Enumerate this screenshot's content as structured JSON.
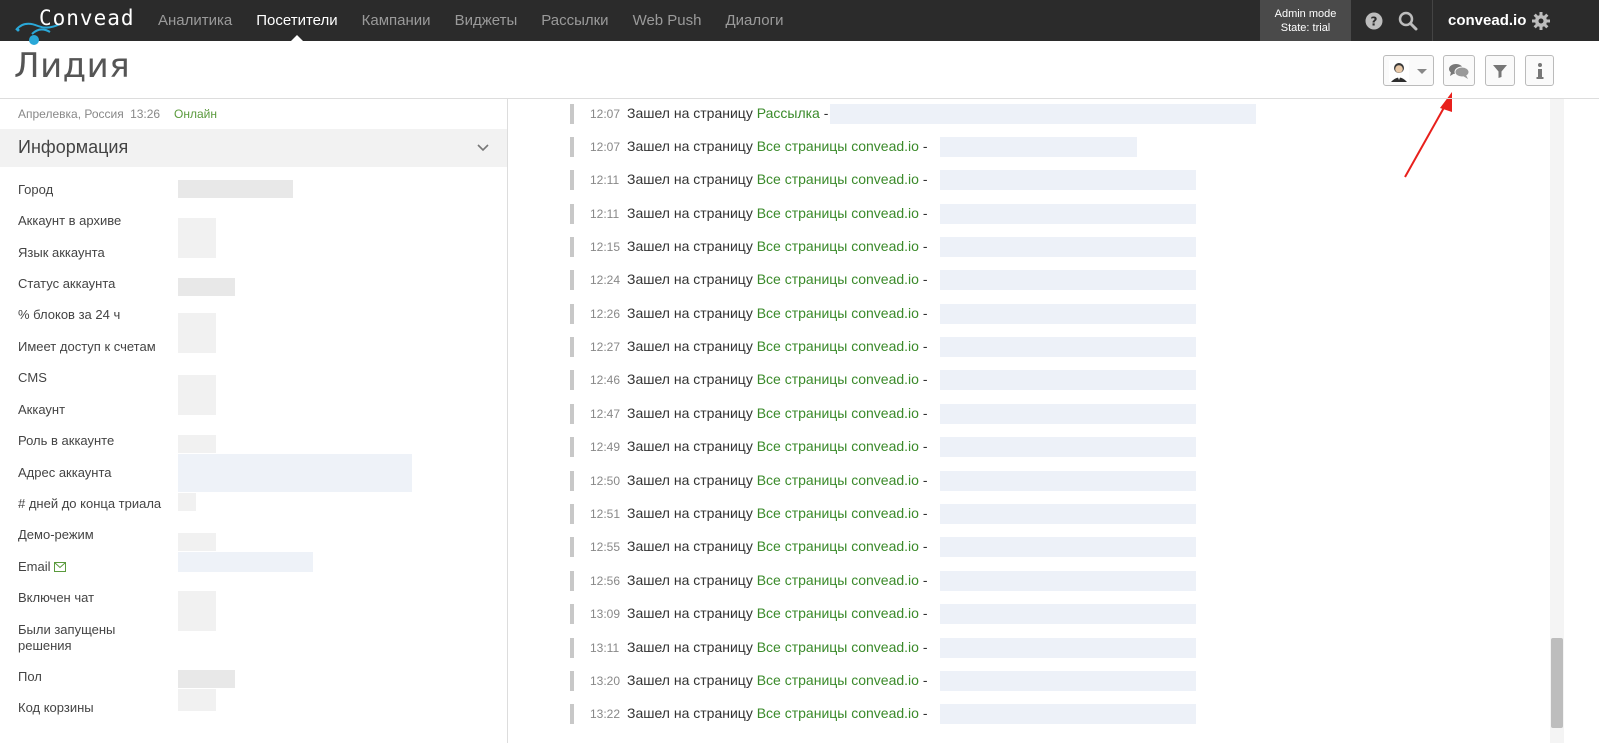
{
  "topbar": {
    "logo_text": "Convead",
    "nav": [
      {
        "label": "Аналитика",
        "active": false
      },
      {
        "label": "Посетители",
        "active": true
      },
      {
        "label": "Кампании",
        "active": false
      },
      {
        "label": "Виджеты",
        "active": false
      },
      {
        "label": "Рассылки",
        "active": false
      },
      {
        "label": "Web Push",
        "active": false
      },
      {
        "label": "Диалоги",
        "active": false
      }
    ],
    "admin_mode": "Admin mode",
    "admin_state": "State: trial",
    "account": "convead.io"
  },
  "visitor": {
    "name": "Лидия",
    "location": "Апрелевка, Россия",
    "time": "13:26",
    "status": "Онлайн"
  },
  "info_section": {
    "title": "Информация",
    "fields": [
      "Город",
      "Аккаунт в архиве",
      "Язык аккаунта",
      "Статус аккаунта",
      "% блоков за 24 ч",
      "Имеет доступ к счетам",
      "CMS",
      "Аккаунт",
      "Роль в аккаунте",
      "Адрес аккаунта",
      "# дней до конца триала",
      "Демо-режим",
      "Email",
      "Включен чат",
      "Были запущены решения",
      "Пол",
      "Код корзины"
    ]
  },
  "feed": {
    "action": "Зашел на страницу",
    "items": [
      {
        "time": "12:07",
        "page": "Рассылка",
        "sep": "-"
      },
      {
        "time": "12:07",
        "page": "Все страницы convead.io",
        "sep": "-"
      },
      {
        "time": "12:11",
        "page": "Все страницы convead.io",
        "sep": "-"
      },
      {
        "time": "12:11",
        "page": "Все страницы convead.io",
        "sep": "-"
      },
      {
        "time": "12:15",
        "page": "Все страницы convead.io",
        "sep": "-"
      },
      {
        "time": "12:24",
        "page": "Все страницы convead.io",
        "sep": "-"
      },
      {
        "time": "12:26",
        "page": "Все страницы convead.io",
        "sep": "-"
      },
      {
        "time": "12:27",
        "page": "Все страницы convead.io",
        "sep": "-"
      },
      {
        "time": "12:46",
        "page": "Все страницы convead.io",
        "sep": "-"
      },
      {
        "time": "12:47",
        "page": "Все страницы convead.io",
        "sep": "-"
      },
      {
        "time": "12:49",
        "page": "Все страницы convead.io",
        "sep": "-"
      },
      {
        "time": "12:50",
        "page": "Все страницы convead.io",
        "sep": "-"
      },
      {
        "time": "12:51",
        "page": "Все страницы convead.io",
        "sep": "-"
      },
      {
        "time": "12:55",
        "page": "Все страницы convead.io",
        "sep": "-"
      },
      {
        "time": "12:56",
        "page": "Все страницы convead.io",
        "sep": "-"
      },
      {
        "time": "13:09",
        "page": "Все страницы convead.io",
        "sep": "-"
      },
      {
        "time": "13:11",
        "page": "Все страницы convead.io",
        "sep": "-"
      },
      {
        "time": "13:20",
        "page": "Все страницы convead.io",
        "sep": "-"
      },
      {
        "time": "13:22",
        "page": "Все страницы convead.io",
        "sep": "-"
      }
    ]
  },
  "colors": {
    "topbar": "#2b2b2b",
    "link_green": "#3a8a2a",
    "online_green": "#5a9a3c",
    "arrow_red": "#e8201c",
    "logo_blue": "#2aa8d8"
  },
  "icons": {
    "help": "question-circle-icon",
    "search": "search-icon",
    "settings": "gear-icon",
    "chat": "chat-bubbles-icon",
    "filter": "funnel-icon",
    "info": "info-icon",
    "collapse": "chevron-down-icon",
    "email": "envelope-icon"
  }
}
